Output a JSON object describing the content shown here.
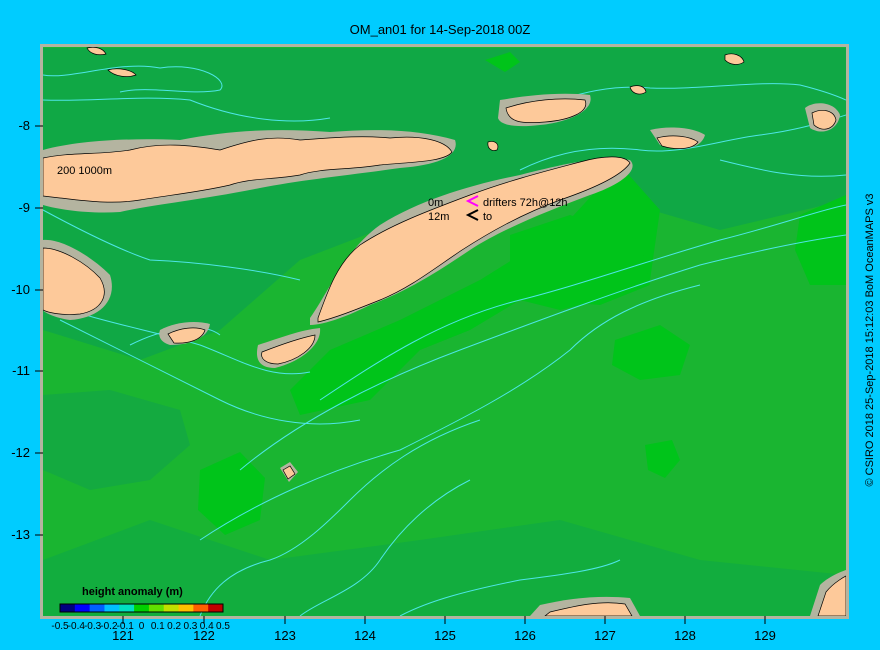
{
  "title": "OM_an01 for 14-Sep-2018 00Z",
  "credit": "© CSIRO 2018   25-Sep-2018 15:12:03 BoM OceanMAPS v3",
  "map": {
    "lon_ticks": [
      "121",
      "122",
      "123",
      "124",
      "125",
      "126",
      "127",
      "128",
      "129"
    ],
    "lat_ticks": [
      "-8",
      "-9",
      "-10",
      "-11",
      "-12",
      "-13"
    ],
    "depth_legend": "200  1000m",
    "drifters": {
      "label_top_left": "0m",
      "label_bottom_left": "12m",
      "label_top_right": "drifters 72h@12h",
      "label_bottom_right": "to",
      "marker_top_color": "#ff00ff",
      "marker_bottom_color": "#000000"
    }
  },
  "colorbar": {
    "title": "height anomaly (m)",
    "ticks": [
      "-0.5",
      "-0.4",
      "-0.3",
      "-0.2",
      "-0.1",
      "0",
      "0.1",
      "0.2",
      "0.3",
      "0.4",
      "0.5"
    ],
    "colors": [
      "#00007f",
      "#0000ff",
      "#0060ff",
      "#00c0ff",
      "#00e0c0",
      "#00d000",
      "#60e000",
      "#c0e000",
      "#ffc000",
      "#ff6000",
      "#c00000"
    ]
  },
  "colors": {
    "background": "#00ccff",
    "sea_base": "#1ab531",
    "sea_dark": "#10a845",
    "sea_light": "#00c41a",
    "land": "#fdc99a",
    "shelf": "#b4b4a0",
    "contour": "#4de6e6"
  }
}
